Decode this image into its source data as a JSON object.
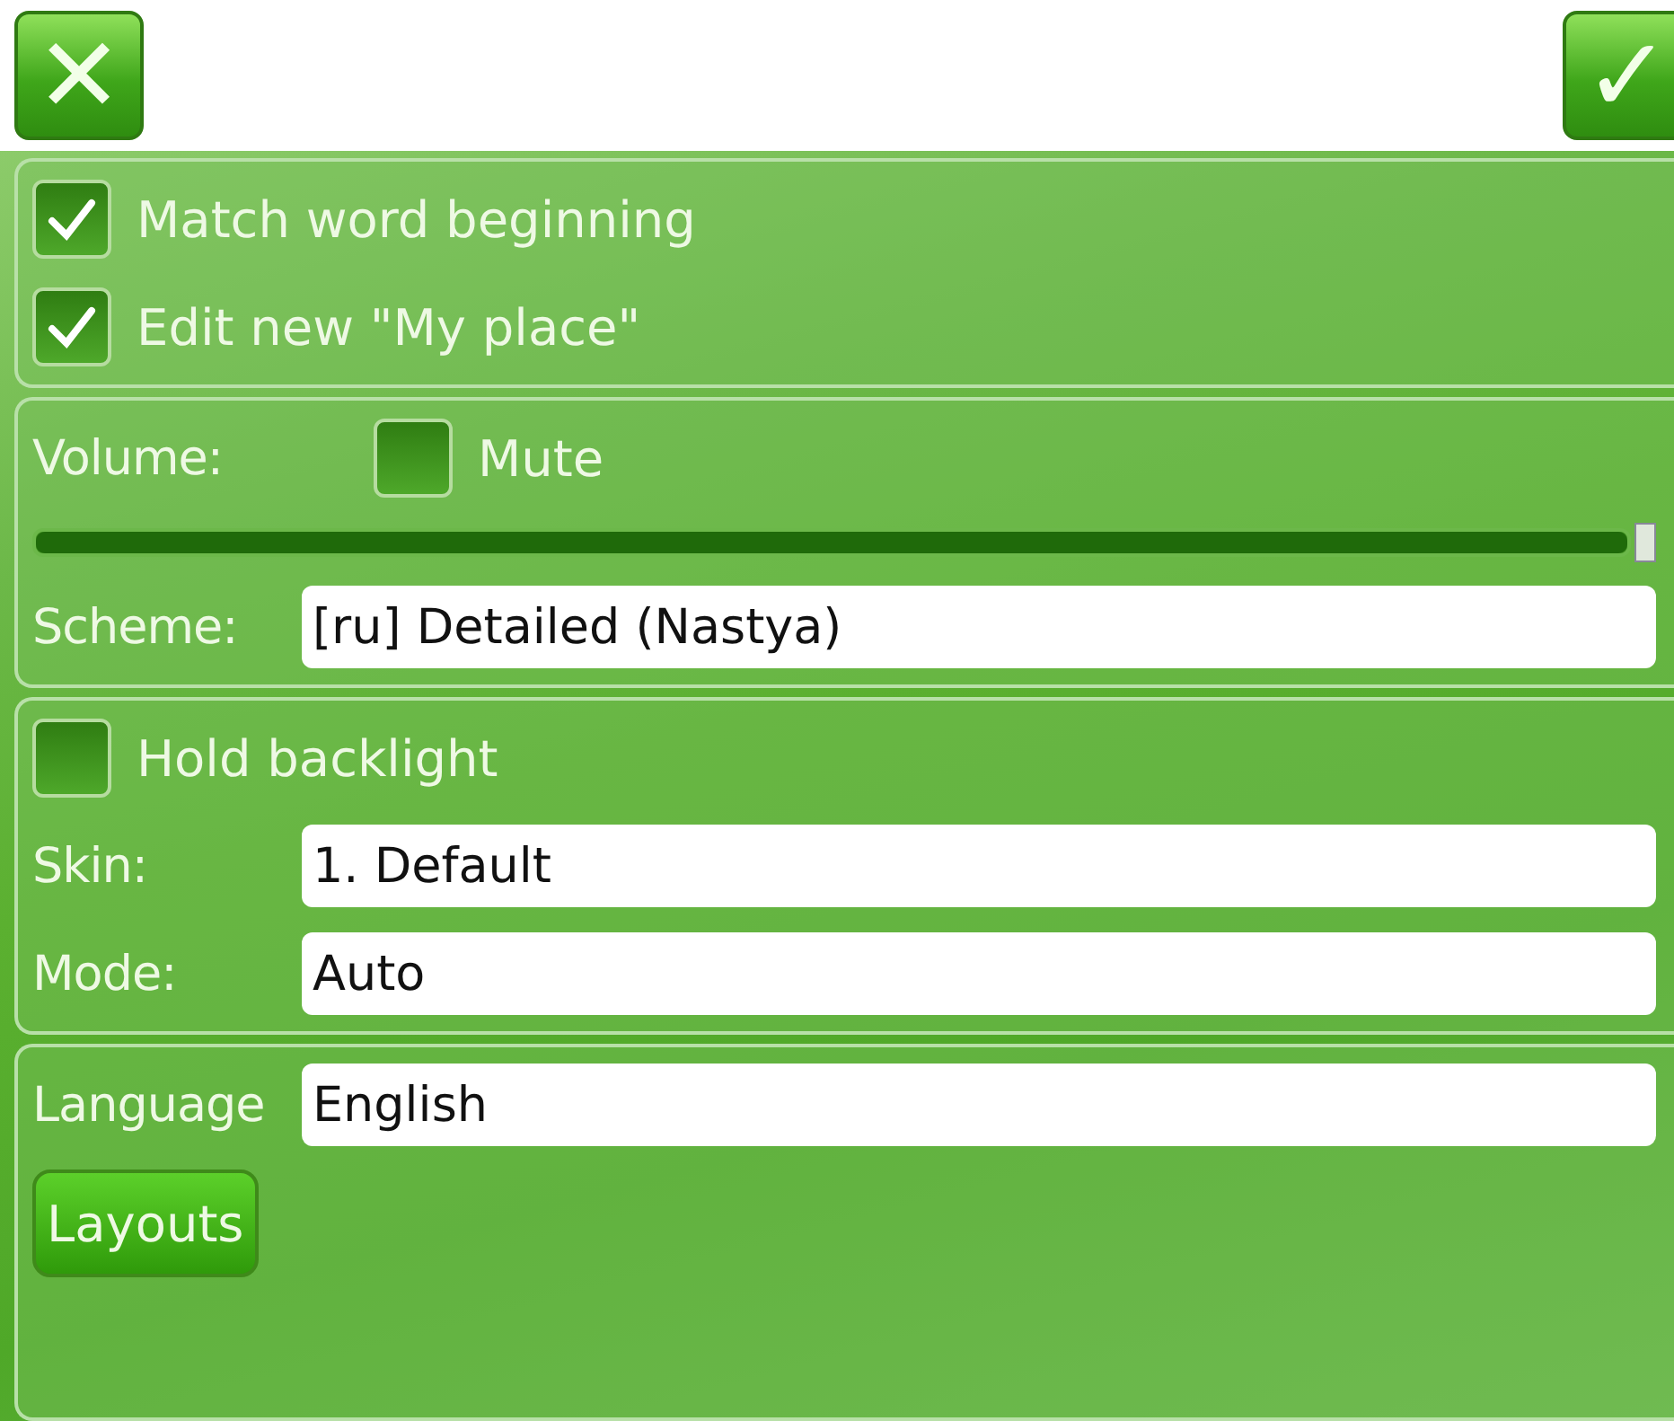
{
  "toolbar": {
    "cancel_label": "✕",
    "ok_label": "✓"
  },
  "sections": [
    {
      "items": [
        {
          "kind": "checkbox",
          "label": "Match word beginning",
          "checked": true
        },
        {
          "kind": "checkbox",
          "label": "Edit new \"My place\"",
          "checked": true
        }
      ]
    },
    {
      "items": [
        {
          "kind": "volume",
          "label": "Volume:",
          "mute_label": "Mute",
          "muted": false
        },
        {
          "kind": "slider",
          "level": 1
        },
        {
          "kind": "field",
          "label": "Scheme:",
          "value": "[ru] Detailed (Nastya)"
        }
      ]
    },
    {
      "items": [
        {
          "kind": "checkbox",
          "label": "Hold backlight",
          "checked": false
        },
        {
          "kind": "field",
          "label": "Skin:",
          "value": "1. Default"
        },
        {
          "kind": "field",
          "label": "Mode:",
          "value": "Auto"
        }
      ]
    },
    {
      "items": [
        {
          "kind": "field",
          "label": "Language",
          "value": "English"
        },
        {
          "kind": "button",
          "label": "Layouts"
        }
      ]
    }
  ]
}
